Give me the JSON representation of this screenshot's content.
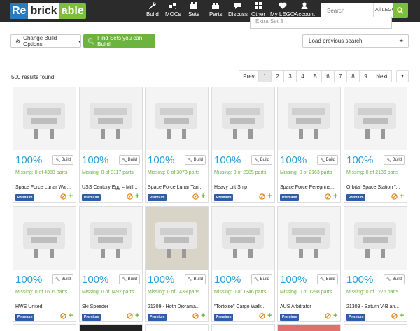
{
  "nav": {
    "logo": {
      "re": "Re",
      "brick": "brick",
      "able": "able"
    },
    "items": [
      {
        "label": "Build",
        "icon": "wrench-icon"
      },
      {
        "label": "MOCs",
        "icon": "idea-icon"
      },
      {
        "label": "Sets",
        "icon": "box-icon"
      },
      {
        "label": "Parts",
        "icon": "brick-icon"
      },
      {
        "label": "Discuss",
        "icon": "chat-icon"
      },
      {
        "label": "Other",
        "icon": "grid-icon"
      },
      {
        "label": "My LEGO",
        "icon": "heart-icon"
      },
      {
        "label": "Account",
        "icon": "user-icon"
      }
    ],
    "search_placeholder": "Search",
    "search_category": "All LEGO"
  },
  "filters": {
    "extra_set": "Extra Set 3",
    "change_options": "Change Build Options",
    "find_sets": "Find Sets you can Build!",
    "load_previous": "Load previous search"
  },
  "results_text": "500 results found.",
  "pagination": {
    "prev": "Prev",
    "pages": [
      "1",
      "2",
      "3",
      "4",
      "5",
      "6",
      "7",
      "8",
      "9"
    ],
    "next": "Next",
    "active": "1"
  },
  "card_common": {
    "build_label": "Build",
    "premium_label": "Premium"
  },
  "cards": [
    {
      "pct": "100%",
      "missing": "Missing: 0 of 4358 parts",
      "name": "Space Force Lunar Wal..."
    },
    {
      "pct": "100%",
      "missing": "Missing: 0 of 3117 parts",
      "name": "USS Century Egg – Mill..."
    },
    {
      "pct": "100%",
      "missing": "Missing: 0 of 3073 parts",
      "name": "Space Force Lunar Tan..."
    },
    {
      "pct": "100%",
      "missing": "Missing: 0 of 2985 parts",
      "name": "Heavy Lift Ship"
    },
    {
      "pct": "100%",
      "missing": "Missing: 0 of 2163 parts",
      "name": "Space Force Peregrine..."
    },
    {
      "pct": "100%",
      "missing": "Missing: 0 of 2136 parts",
      "name": "Orbital Space Station \"..."
    },
    {
      "pct": "100%",
      "missing": "Missing: 0 of 1606 parts",
      "name": "HWS United"
    },
    {
      "pct": "100%",
      "missing": "Missing: 0 of 1492 parts",
      "name": "Ski Speeder"
    },
    {
      "pct": "100%",
      "missing": "Missing: 0 of 1439 parts",
      "name": "21309 - Hoth Diorama..."
    },
    {
      "pct": "100%",
      "missing": "Missing: 0 of 1346 parts",
      "name": "\"Tortoise\" Cargo Walk..."
    },
    {
      "pct": "100%",
      "missing": "Missing: 0 of 1298 parts",
      "name": "AUS Arbitrator"
    },
    {
      "pct": "100%",
      "missing": "Missing: 0 of 1275 parts",
      "name": "21309 - Saturn V-B an..."
    }
  ],
  "colors": {
    "nav_bg": "#2b2b2b",
    "accent_green": "#6cb33f",
    "accent_blue": "#2a9fd8",
    "premium_blue": "#2f5da8"
  }
}
